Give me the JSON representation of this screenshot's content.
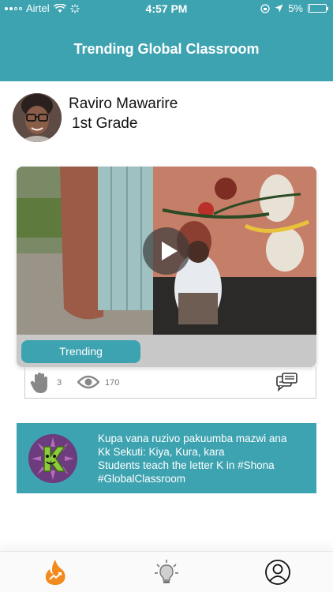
{
  "status_bar": {
    "carrier": "Airtel",
    "time": "4:57 PM",
    "battery": "5%",
    "battery_level": 0.05
  },
  "header": {
    "title": "Trending Global Classroom"
  },
  "profile": {
    "name": "Raviro Mawarire",
    "grade": "1st Grade"
  },
  "video": {
    "tag_label": "Trending"
  },
  "stats": {
    "raise_hand_count": "3",
    "views_count": "170"
  },
  "lesson": {
    "lines": [
      "Kupa vana ruzivo pakuumba mazwi ana",
      "Kk Sekuti: Kiya, Kura, kara",
      "Students teach the letter K in #Shona",
      "#GlobalClassroom"
    ],
    "badge_letter": "K"
  },
  "nav": {
    "items": [
      "trending-flame-icon",
      "lightbulb-icon",
      "profile-icon"
    ]
  },
  "colors": {
    "accent": "#3ea3b1",
    "flame": "#f28a1e"
  }
}
